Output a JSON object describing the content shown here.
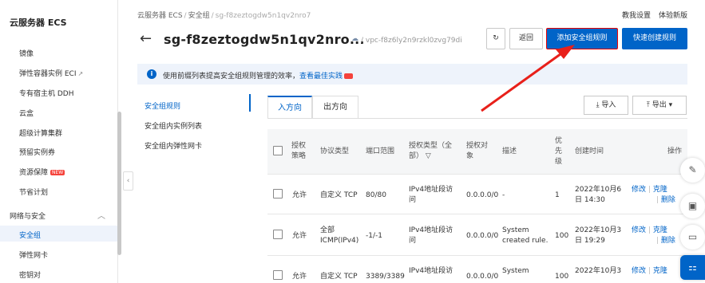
{
  "sidebar": {
    "title": "云服务器 ECS",
    "items": [
      {
        "label": "镜像",
        "ext": false,
        "badge": ""
      },
      {
        "label": "弹性容器实例 ECI",
        "ext": true,
        "badge": ""
      },
      {
        "label": "专有宿主机 DDH",
        "ext": false,
        "badge": ""
      },
      {
        "label": "云盒",
        "ext": false,
        "badge": ""
      },
      {
        "label": "超级计算集群",
        "ext": false,
        "badge": ""
      },
      {
        "label": "预留实例券",
        "ext": false,
        "badge": ""
      },
      {
        "label": "资源保障",
        "ext": false,
        "badge": "NEW"
      },
      {
        "label": "节省计划",
        "ext": false,
        "badge": ""
      }
    ],
    "group": "网络与安全",
    "group_items": [
      {
        "label": "安全组",
        "active": true
      },
      {
        "label": "弹性网卡",
        "active": false
      },
      {
        "label": "密钥对",
        "active": false
      }
    ],
    "collapse_glyph": "‹"
  },
  "header": {
    "breadcrumb": [
      "云服务器 ECS",
      "安全组",
      "sg-f8zeztogdw5n1qv2nro7"
    ],
    "top_links": [
      "教我设置",
      "体验新版"
    ],
    "back_glyph": "←",
    "title": "sg-f8zeztogdw5n1qv2nro...",
    "vpc": "/ vpc-f8z6ly2n9rzkl0zvg79di",
    "buttons": {
      "refresh": "↻",
      "back": "返回",
      "add_rule": "添加安全组规则",
      "quick_create": "快速创建规则"
    }
  },
  "info_bar": {
    "icon": "i",
    "text": "使用前缀列表提高安全组规则管理的效率，",
    "link": "查看最佳实践"
  },
  "subnav": [
    {
      "label": "安全组规则",
      "active": true
    },
    {
      "label": "安全组内实例列表",
      "active": false
    },
    {
      "label": "安全组内弹性网卡",
      "active": false
    }
  ],
  "tabs": [
    {
      "label": "入方向",
      "active": true
    },
    {
      "label": "出方向",
      "active": false
    }
  ],
  "toolbar": {
    "import": "导入",
    "export": "导出"
  },
  "table": {
    "headers": {
      "policy_1": "授权",
      "policy_2": "策略",
      "protocol": "协议类型",
      "port": "端口范围",
      "auth_type_1": "授权类型（全",
      "auth_type_2": "部）",
      "auth_obj_1": "授权对",
      "auth_obj_2": "象",
      "desc": "描述",
      "priority_1": "优",
      "priority_2": "先",
      "priority_3": "级",
      "created": "创建时间",
      "ops": "操作"
    },
    "rows": [
      {
        "policy": "允许",
        "protocol_1": "自定义 TCP",
        "protocol_2": "",
        "port": "80/80",
        "auth_type_1": "IPv4地址段访",
        "auth_type_2": "问",
        "auth_obj": "0.0.0.0/0",
        "desc_1": "-",
        "desc_2": "",
        "priority": "1",
        "created_1": "2022年10月6",
        "created_2": "日 14:30",
        "edit": "修改",
        "clone": "克隆",
        "delete": "删除"
      },
      {
        "policy": "允许",
        "protocol_1": "全部",
        "protocol_2": "ICMP(IPv4)",
        "port": "-1/-1",
        "auth_type_1": "IPv4地址段访",
        "auth_type_2": "问",
        "auth_obj": "0.0.0.0/0",
        "desc_1": "System",
        "desc_2": "created rule.",
        "priority": "100",
        "created_1": "2022年10月3",
        "created_2": "日 19:29",
        "edit": "修改",
        "clone": "克隆",
        "delete": "删除"
      },
      {
        "policy": "允许",
        "protocol_1": "自定义 TCP",
        "protocol_2": "",
        "port": "3389/3389",
        "auth_type_1": "IPv4地址段访",
        "auth_type_2": "",
        "auth_obj": "0.0.0.0/0",
        "desc_1": "System",
        "desc_2": "",
        "priority": "100",
        "created_1": "2022年10月3",
        "created_2": "",
        "edit": "修改",
        "clone": "克隆",
        "delete": "删除"
      }
    ]
  },
  "colors": {
    "primary": "#0064c8",
    "annotation_arrow": "#e8201a",
    "badge_red": "#f5423b",
    "info_bg": "#eef3fb"
  }
}
